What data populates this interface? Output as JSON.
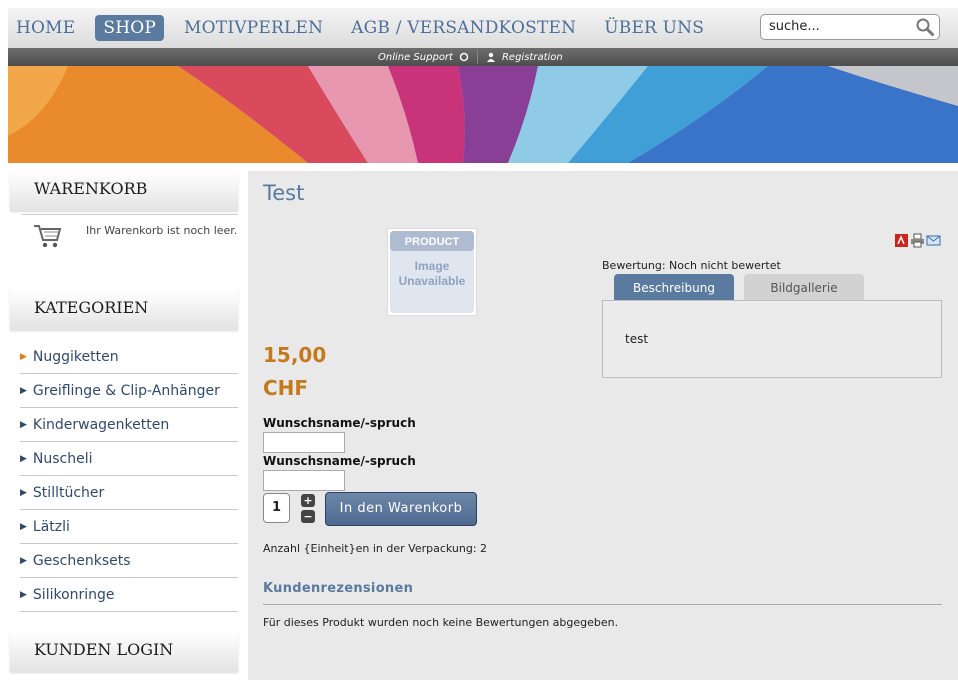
{
  "nav": {
    "items": [
      {
        "label": "HOME",
        "active": false
      },
      {
        "label": "SHOP",
        "active": true
      },
      {
        "label": "MOTIVPERLEN",
        "active": false
      },
      {
        "label": "AGB / VERSANDKOSTEN",
        "active": false
      },
      {
        "label": "ÜBER UNS",
        "active": false
      }
    ]
  },
  "search": {
    "value": "suche..."
  },
  "subbar": {
    "support_label": "Online Support",
    "registration_label": "Registration"
  },
  "sidebar": {
    "cart": {
      "heading": "WARENKORB",
      "empty_text": "Ihr Warenkorb ist noch leer."
    },
    "categories": {
      "heading": "KATEGORIEN",
      "items": [
        "Nuggiketten",
        "Greiflinge & Clip-Anhänger",
        "Kinderwagenketten",
        "Nuscheli",
        "Stilltücher",
        "Lätzli",
        "Geschenksets",
        "Silikonringe"
      ]
    },
    "login": {
      "heading": "KUNDEN LOGIN"
    }
  },
  "product": {
    "title": "Test",
    "image_placeholder": {
      "top": "PRODUCT",
      "line1": "Image",
      "line2": "Unavailable"
    },
    "price_amount": "15,00",
    "price_currency": "CHF",
    "field1_label": "Wunschsname/-spruch",
    "field2_label": "Wunschsname/-spruch",
    "quantity": "1",
    "add_to_cart_label": "In den Warenkorb",
    "packaging_info": "Anzahl {Einheit}en in der Verpackung: 2",
    "rating_text": "Bewertung: Noch nicht bewertet",
    "tabs": [
      {
        "label": "Beschreibung",
        "active": true
      },
      {
        "label": "Bildgallerie",
        "active": false
      }
    ],
    "description": "test",
    "reviews_heading": "Kundenrezensionen",
    "reviews_empty": "Für dieses Produkt wurden noch keine Bewertungen abgegeben."
  },
  "colors": {
    "accent": "#5a7aa0",
    "price": "#c47a1c"
  },
  "icons": [
    "search-icon",
    "cart-icon",
    "pdf-icon",
    "print-icon",
    "email-icon",
    "plus-icon",
    "minus-icon"
  ]
}
